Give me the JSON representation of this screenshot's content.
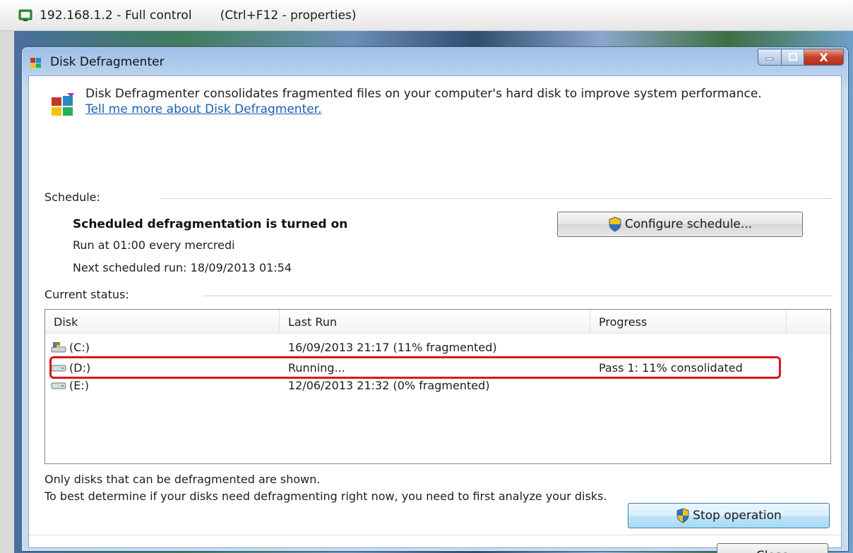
{
  "remote_bar": {
    "title": "192.168.1.2  - Full control",
    "hint": "(Ctrl+F12 - properties)"
  },
  "window": {
    "title": "Disk Defragmenter",
    "close_glyph": "X"
  },
  "header": {
    "description": "Disk Defragmenter consolidates fragmented files on your computer's hard disk to improve system performance. ",
    "link": "Tell me more about Disk Defragmenter."
  },
  "schedule": {
    "label": "Schedule:",
    "status": "Scheduled defragmentation is turned on",
    "run_at": "Run at 01:00 every mercredi",
    "next_run": "Next scheduled run: 18/09/2013 01:54",
    "configure_label": "Configure schedule..."
  },
  "status": {
    "label": "Current status:",
    "columns": [
      "Disk",
      "Last Run",
      "Progress"
    ],
    "disks": [
      {
        "disk": "(C:)",
        "last_run": "16/09/2013 21:17 (11% fragmented)",
        "progress": "",
        "icon": "system-drive-icon"
      },
      {
        "disk": "(D:)",
        "last_run": "Running...",
        "progress": "Pass 1: 11% consolidated",
        "icon": "drive-icon"
      },
      {
        "disk": "(E:)",
        "last_run": "12/06/2013 21:32 (0% fragmented)",
        "progress": "",
        "icon": "drive-icon"
      }
    ]
  },
  "notes": {
    "line1": "Only disks that can be defragmented are shown.",
    "line2": "To best determine if your disks need defragmenting right now, you need to first analyze your disks."
  },
  "buttons": {
    "stop": "Stop operation",
    "close": "Close"
  },
  "colors": {
    "highlight": "#d9151b",
    "link": "#1a5fb4"
  }
}
